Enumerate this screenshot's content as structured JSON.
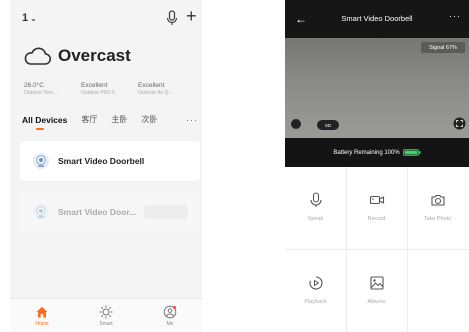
{
  "home": {
    "name": "1",
    "weather": {
      "condition": "Overcast"
    },
    "stats": [
      {
        "value": "26.0°C",
        "label": "Outdoor Tem..."
      },
      {
        "value": "Excellent",
        "label": "Outdoor PM2.5"
      },
      {
        "value": "Excellent",
        "label": "Outdoor Air Q..."
      }
    ],
    "tabs": [
      "All Devices",
      "客厅",
      "主卧",
      "次卧"
    ],
    "more": "···",
    "devices": [
      {
        "name": "Smart Video Doorbell",
        "status": "online"
      },
      {
        "name": "Smart Video Door...",
        "status": "offline"
      }
    ],
    "nav": [
      {
        "label": "Home",
        "icon": "home-icon"
      },
      {
        "label": "Smart",
        "icon": "sun-icon"
      },
      {
        "label": "Me",
        "icon": "person-icon"
      }
    ]
  },
  "doorbell": {
    "title": "Smart Video Doorbell",
    "more": "···",
    "signal": "Signal 67%",
    "sd_label": "SD",
    "battery_text": "Battery Remaining 100%",
    "battery_level": 1.0,
    "controls": [
      {
        "label": "Speak",
        "icon": "microphone-icon"
      },
      {
        "label": "Record",
        "icon": "video-camera-icon"
      },
      {
        "label": "Take Photo",
        "icon": "camera-icon"
      },
      {
        "label": "Playback",
        "icon": "playback-icon"
      },
      {
        "label": "Albums",
        "icon": "image-icon"
      }
    ]
  },
  "colors": {
    "accent": "#ff6b1a",
    "battery_green": "#3fd36a",
    "header_bg": "#161616"
  }
}
